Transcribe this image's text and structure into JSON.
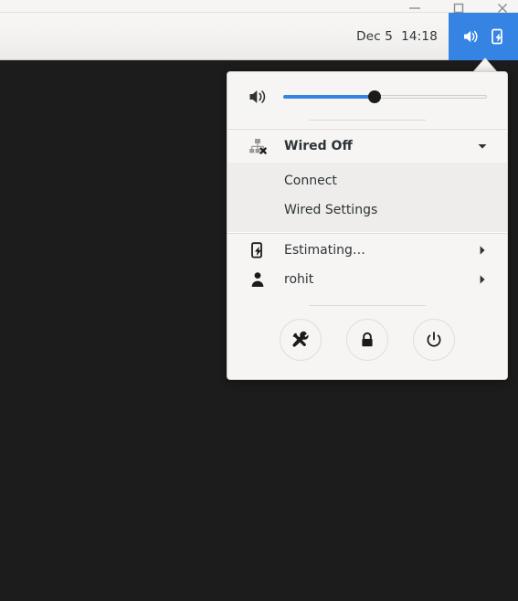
{
  "window_controls": [
    {
      "name": "minimize",
      "glyph": "minimize-icon"
    },
    {
      "name": "maximize",
      "glyph": "maximize-icon"
    },
    {
      "name": "close",
      "glyph": "close-icon"
    }
  ],
  "panel": {
    "clock": "Dec 5  14:18",
    "status_area": {
      "active": true,
      "accent_color": "#3584e4",
      "icons": [
        "volume-high-icon",
        "battery-charging-icon"
      ]
    }
  },
  "desktop": {
    "background_color": "#1c1c1c"
  },
  "menu": {
    "volume": {
      "icon": "volume-high-icon",
      "value_percent": 45,
      "fill_color": "#3584e4"
    },
    "network": {
      "icon": "wired-network-offline-icon",
      "label": "Wired Off",
      "expanded": true,
      "expander_icon": "chevron-down-icon",
      "submenu": [
        {
          "label": "Connect"
        },
        {
          "label": "Wired Settings"
        }
      ]
    },
    "system_items": [
      {
        "icon": "battery-charging-icon",
        "label": "Estimating…",
        "arrow_icon": "chevron-right-icon"
      },
      {
        "icon": "user-avatar-icon",
        "label": "rohit",
        "arrow_icon": "chevron-right-icon"
      }
    ],
    "actions": [
      {
        "name": "settings",
        "icon": "settings-tools-icon"
      },
      {
        "name": "lock",
        "icon": "lock-icon"
      },
      {
        "name": "power",
        "icon": "power-icon"
      }
    ]
  }
}
